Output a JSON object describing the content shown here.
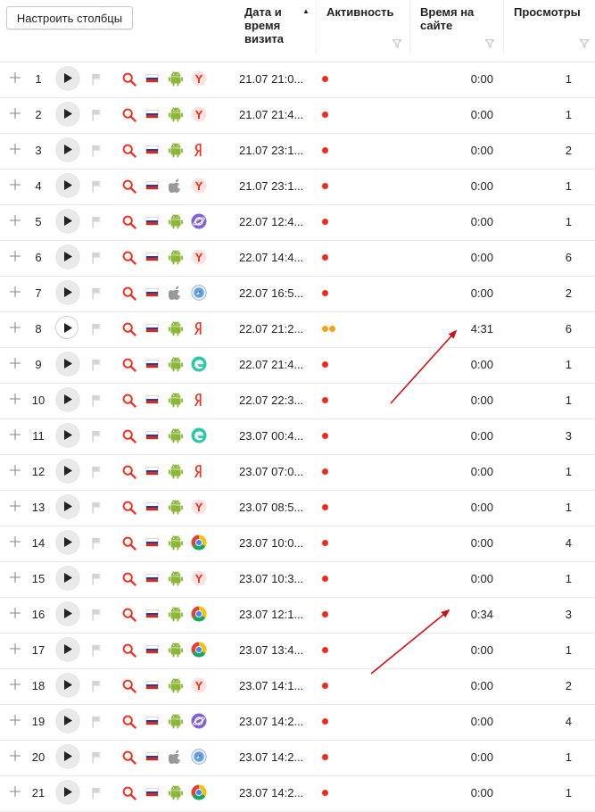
{
  "toolbar": {
    "configure_columns_label": "Настроить столбцы"
  },
  "columns": {
    "datetime": {
      "line1": "Дата и",
      "line2": "время",
      "line3": "визита",
      "sort": "asc"
    },
    "activity": {
      "label": "Активность"
    },
    "time_on_site": {
      "line1": "Время на",
      "line2": "сайте"
    },
    "views": {
      "label": "Просмотры"
    }
  },
  "colors": {
    "activity_red": "#e73121",
    "activity_orange": "#f3a21e",
    "annotation_arrow": "#c4151c",
    "search_icon": "#e73121"
  },
  "visits": [
    {
      "n": "1",
      "dt": "21.07 21:0...",
      "os": "android",
      "browser": "yandex",
      "activity": [
        "red"
      ],
      "time": "0:00",
      "views": "1",
      "playing": false
    },
    {
      "n": "2",
      "dt": "21.07 21:4...",
      "os": "android",
      "browser": "yandex",
      "activity": [
        "red"
      ],
      "time": "0:00",
      "views": "1",
      "playing": false
    },
    {
      "n": "3",
      "dt": "21.07 23:1...",
      "os": "android",
      "browser": "yandex-ya",
      "activity": [
        "red"
      ],
      "time": "0:00",
      "views": "2",
      "playing": false
    },
    {
      "n": "4",
      "dt": "21.07 23:1...",
      "os": "apple",
      "browser": "yandex",
      "activity": [
        "red"
      ],
      "time": "0:00",
      "views": "1",
      "playing": false
    },
    {
      "n": "5",
      "dt": "22.07 12:4...",
      "os": "android",
      "browser": "samsung",
      "activity": [
        "red"
      ],
      "time": "0:00",
      "views": "1",
      "playing": false
    },
    {
      "n": "6",
      "dt": "22.07 14:4...",
      "os": "android",
      "browser": "yandex",
      "activity": [
        "red"
      ],
      "time": "0:00",
      "views": "6",
      "playing": false
    },
    {
      "n": "7",
      "dt": "22.07 16:5...",
      "os": "apple",
      "browser": "safari",
      "activity": [
        "red"
      ],
      "time": "0:00",
      "views": "2",
      "playing": false
    },
    {
      "n": "8",
      "dt": "22.07 21:2...",
      "os": "android",
      "browser": "yandex-ya",
      "activity": [
        "orange",
        "orange"
      ],
      "time": "4:31",
      "views": "6",
      "playing": true
    },
    {
      "n": "9",
      "dt": "22.07 21:4...",
      "os": "android",
      "browser": "edge",
      "activity": [
        "red"
      ],
      "time": "0:00",
      "views": "1",
      "playing": false
    },
    {
      "n": "10",
      "dt": "22.07 22:3...",
      "os": "android",
      "browser": "yandex-ya",
      "activity": [
        "red"
      ],
      "time": "0:00",
      "views": "1",
      "playing": false
    },
    {
      "n": "11",
      "dt": "23.07 00:4...",
      "os": "android",
      "browser": "edge",
      "activity": [
        "red"
      ],
      "time": "0:00",
      "views": "3",
      "playing": false
    },
    {
      "n": "12",
      "dt": "23.07 07:0...",
      "os": "android",
      "browser": "yandex-ya",
      "activity": [
        "red"
      ],
      "time": "0:00",
      "views": "1",
      "playing": false
    },
    {
      "n": "13",
      "dt": "23.07 08:5...",
      "os": "android",
      "browser": "yandex",
      "activity": [
        "red"
      ],
      "time": "0:00",
      "views": "1",
      "playing": false
    },
    {
      "n": "14",
      "dt": "23.07 10:0...",
      "os": "android",
      "browser": "chrome",
      "activity": [
        "red"
      ],
      "time": "0:00",
      "views": "4",
      "playing": false
    },
    {
      "n": "15",
      "dt": "23.07 10:3...",
      "os": "android",
      "browser": "yandex",
      "activity": [
        "red"
      ],
      "time": "0:00",
      "views": "1",
      "playing": false
    },
    {
      "n": "16",
      "dt": "23.07 12:1...",
      "os": "android",
      "browser": "chrome",
      "activity": [
        "red"
      ],
      "time": "0:34",
      "views": "3",
      "playing": false
    },
    {
      "n": "17",
      "dt": "23.07 13:4...",
      "os": "android",
      "browser": "chrome",
      "activity": [
        "red"
      ],
      "time": "0:00",
      "views": "1",
      "playing": false
    },
    {
      "n": "18",
      "dt": "23.07 14:1...",
      "os": "android",
      "browser": "yandex",
      "activity": [
        "red"
      ],
      "time": "0:00",
      "views": "2",
      "playing": false
    },
    {
      "n": "19",
      "dt": "23.07 14:2...",
      "os": "android",
      "browser": "samsung",
      "activity": [
        "red"
      ],
      "time": "0:00",
      "views": "4",
      "playing": false
    },
    {
      "n": "20",
      "dt": "23.07 14:2...",
      "os": "apple",
      "browser": "safari",
      "activity": [
        "red"
      ],
      "time": "0:00",
      "views": "1",
      "playing": false
    },
    {
      "n": "21",
      "dt": "23.07 14:2...",
      "os": "android",
      "browser": "chrome",
      "activity": [
        "red"
      ],
      "time": "0:00",
      "views": "1",
      "playing": false
    }
  ]
}
